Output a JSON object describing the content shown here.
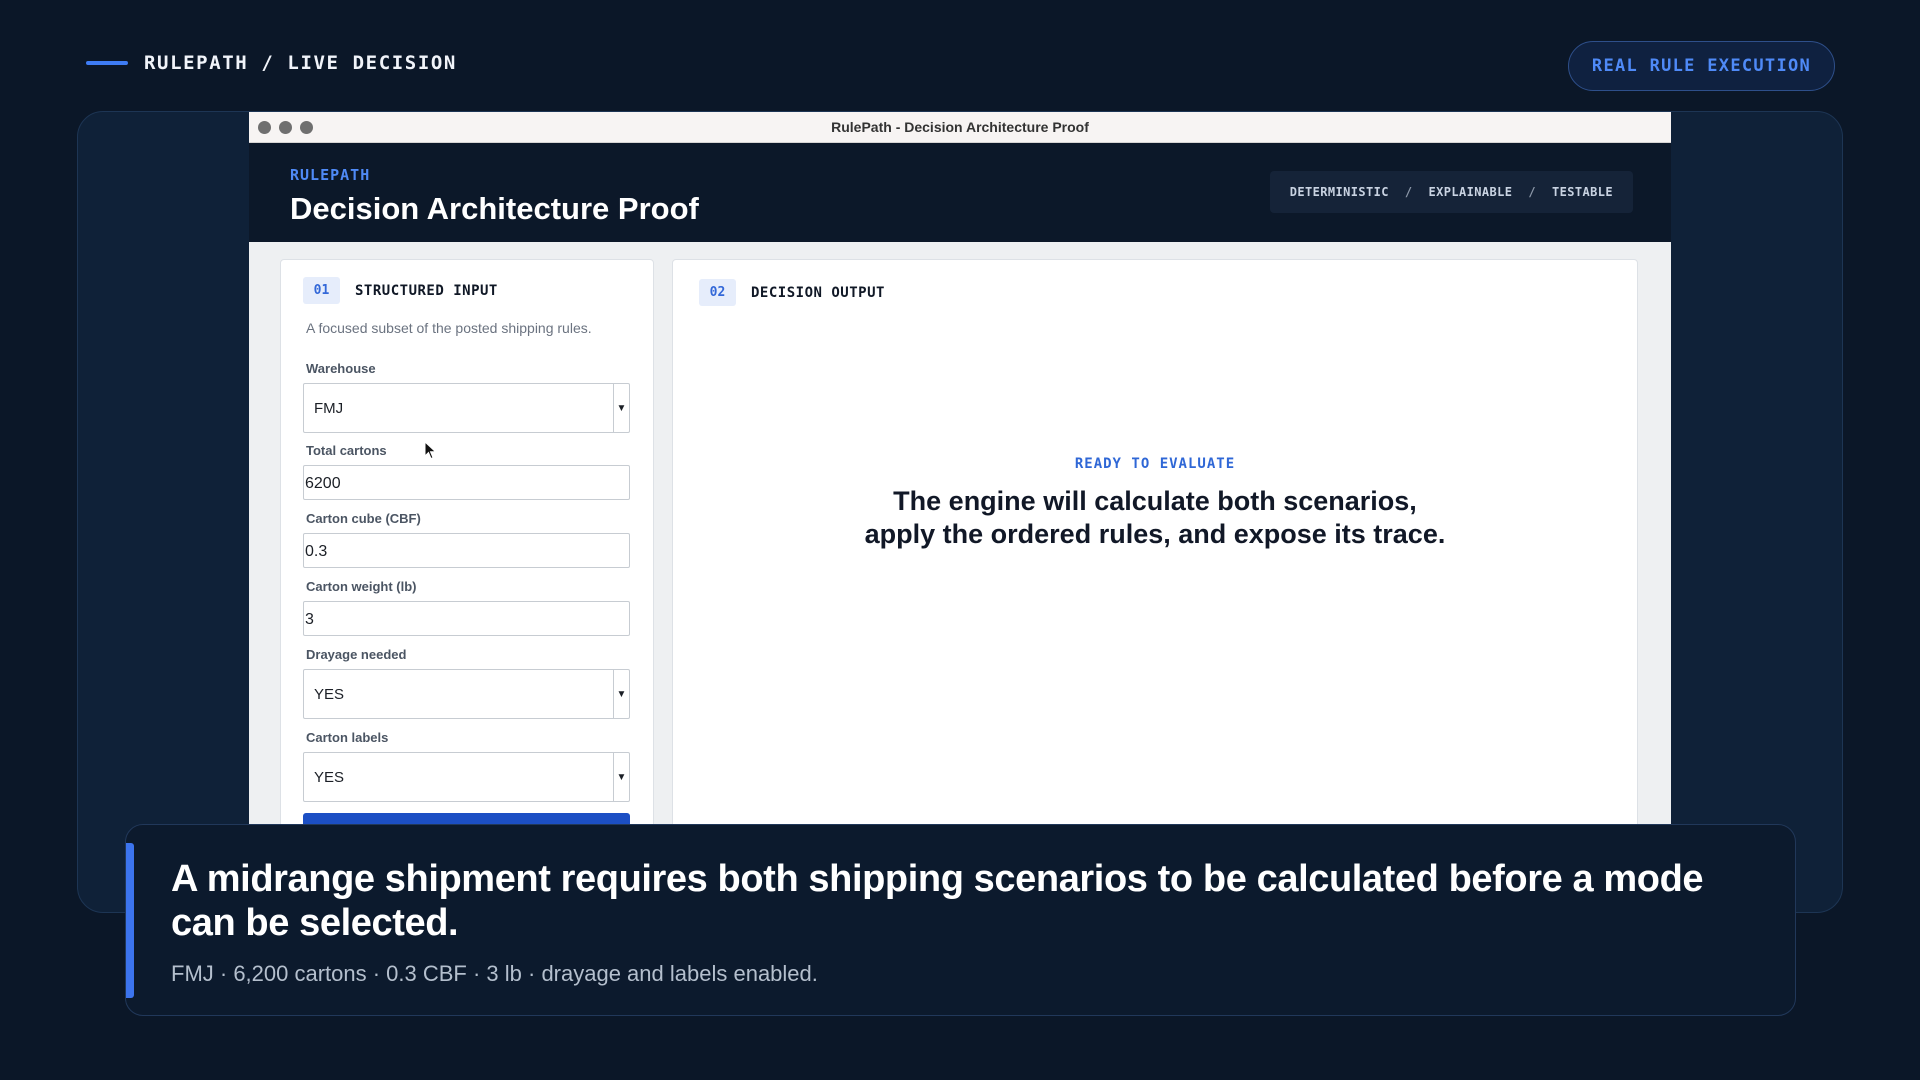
{
  "slide": {
    "brand": "RULEPATH / LIVE DECISION",
    "badge": "REAL RULE EXECUTION"
  },
  "window": {
    "title": "RulePath - Decision Architecture Proof"
  },
  "app": {
    "eyebrow": "RULEPATH",
    "title": "Decision Architecture Proof",
    "tags": [
      "DETERMINISTIC",
      "EXPLAINABLE",
      "TESTABLE"
    ],
    "tag_separator": "/"
  },
  "input_panel": {
    "step": "01",
    "label": "STRUCTURED INPUT",
    "description": "A focused subset of the posted shipping rules.",
    "fields": {
      "warehouse": {
        "label": "Warehouse",
        "value": "FMJ"
      },
      "total_cartons": {
        "label": "Total cartons",
        "value": "6200"
      },
      "carton_cube": {
        "label": "Carton cube (CBF)",
        "value": "0.3"
      },
      "carton_weight": {
        "label": "Carton weight (lb)",
        "value": "3"
      },
      "drayage": {
        "label": "Drayage needed",
        "value": "YES"
      },
      "labels": {
        "label": "Carton labels",
        "value": "YES"
      }
    }
  },
  "output_panel": {
    "step": "02",
    "label": "DECISION OUTPUT",
    "status": "READY TO EVALUATE",
    "message_line1": "The engine will calculate both scenarios,",
    "message_line2": "apply the ordered rules, and expose its trace."
  },
  "caption": {
    "headline": "A midrange shipment requires both shipping scenarios to be calculated before a mode can be selected.",
    "subline": "FMJ · 6,200 cartons · 0.3 CBF · 3 lb · drayage and labels enabled."
  },
  "colors": {
    "background": "#0b1728",
    "accent": "#3e7cf5",
    "primary_button": "#1c4fc4"
  }
}
